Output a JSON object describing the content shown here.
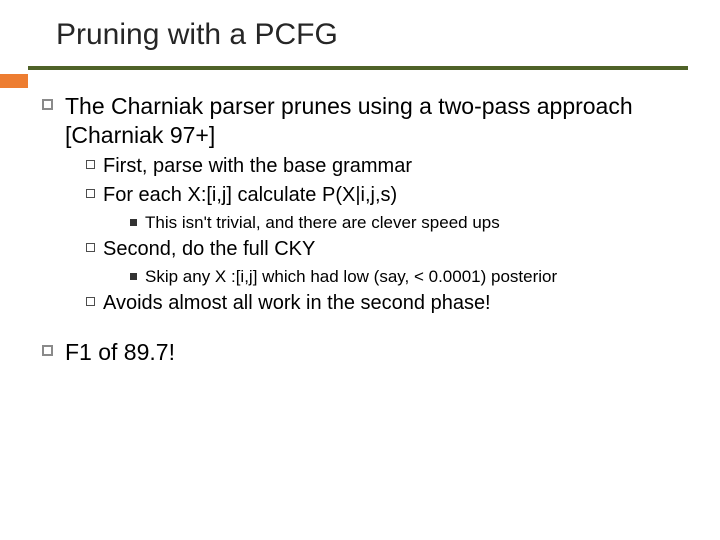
{
  "title": "Pruning with a PCFG",
  "items": [
    {
      "level": 1,
      "text": "The Charniak parser prunes using a two-pass approach [Charniak 97+]"
    },
    {
      "level": 2,
      "text": "First, parse with the base grammar"
    },
    {
      "level": 2,
      "text": "For each X:[i,j] calculate P(X|i,j,s)"
    },
    {
      "level": 3,
      "text": "This isn't trivial, and there are clever speed ups"
    },
    {
      "level": 2,
      "text": "Second, do the full CKY"
    },
    {
      "level": 3,
      "text": "Skip any X :[i,j] which had low (say, < 0.0001) posterior"
    },
    {
      "level": 2,
      "text": "Avoids almost all work in the second phase!"
    },
    {
      "level": 1,
      "text": "F1 of 89.7!"
    }
  ]
}
